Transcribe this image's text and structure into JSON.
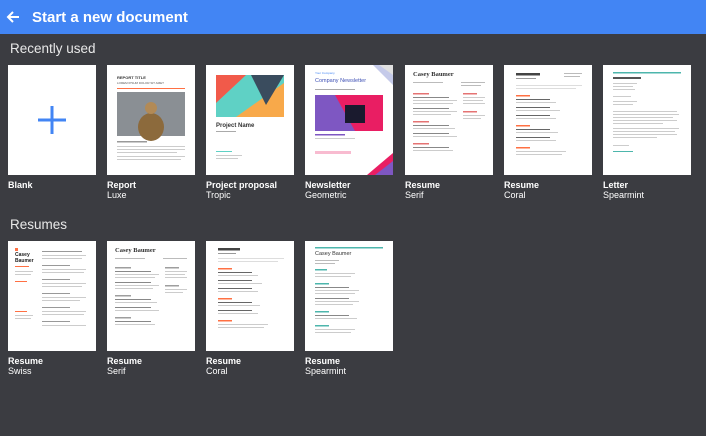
{
  "header": {
    "title": "Start a new document",
    "accent": "#4285f4",
    "back_icon": "arrow-left-icon"
  },
  "sections": {
    "recent": {
      "label": "Recently used"
    },
    "resumes": {
      "label": "Resumes"
    }
  },
  "tiles": {
    "blank": {
      "name": "Blank",
      "style": ""
    },
    "report": {
      "name": "Report",
      "style": "Luxe",
      "doc_title": "REPORT TITLE",
      "doc_sub": "LOREM IPSUM DOLOR SIT AMET"
    },
    "proposal": {
      "name": "Project proposal",
      "style": "Tropic",
      "doc_title": "Project Name"
    },
    "newsletter": {
      "name": "Newsletter",
      "style": "Geometric",
      "doc_kicker": "Your Company",
      "doc_title": "Company Newsletter"
    },
    "resume_serif": {
      "name": "Resume",
      "style": "Serif",
      "doc_name": "Casey Baumer"
    },
    "resume_coral": {
      "name": "Resume",
      "style": "Coral"
    },
    "letter": {
      "name": "Letter",
      "style": "Spearmint"
    },
    "r_swiss": {
      "name": "Resume",
      "style": "Swiss",
      "doc_name": "Casey Baumer"
    },
    "r_serif": {
      "name": "Resume",
      "style": "Serif",
      "doc_name": "Casey Baumer"
    },
    "r_coral": {
      "name": "Resume",
      "style": "Coral"
    },
    "r_spearmint": {
      "name": "Resume",
      "style": "Spearmint",
      "doc_name": "Casey Baumer"
    }
  }
}
